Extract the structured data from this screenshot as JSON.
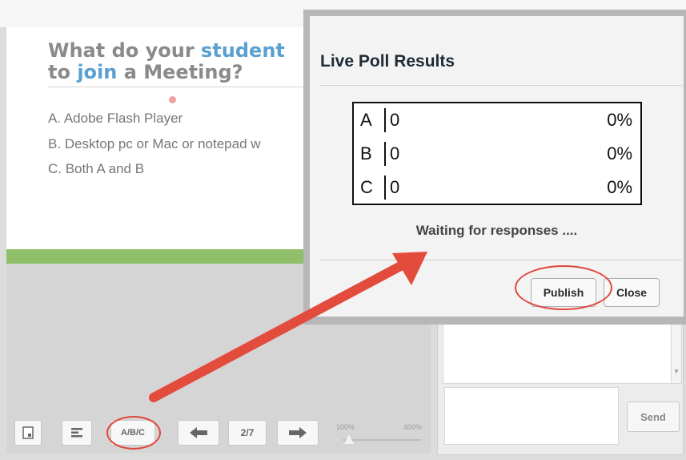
{
  "slide": {
    "title_line1_a": "What do your ",
    "title_line1_b": "student",
    "title_line2_a": "to ",
    "title_line2_b": "join",
    "title_line2_c": " a Meeting?",
    "options": [
      "A. Adobe Flash Player",
      "B. Desktop pc or Mac or notepad w",
      "C. Both A and B"
    ]
  },
  "toolbar": {
    "poll_label": "A/B/C",
    "page_label": "2/7",
    "zoom_min": "100%",
    "zoom_max": "400%"
  },
  "chat": {
    "send_label": "Send"
  },
  "dialog": {
    "title": "Live Poll Results",
    "results": [
      {
        "letter": "A",
        "count": "0",
        "percent": "0%"
      },
      {
        "letter": "B",
        "count": "0",
        "percent": "0%"
      },
      {
        "letter": "C",
        "count": "0",
        "percent": "0%"
      }
    ],
    "status": "Waiting for responses ....",
    "publish_label": "Publish",
    "close_label": "Close"
  },
  "colors": {
    "accent_link": "#5aa0d0",
    "annotation_red": "#e0453b",
    "slide_footer_green": "#8fbf68"
  }
}
